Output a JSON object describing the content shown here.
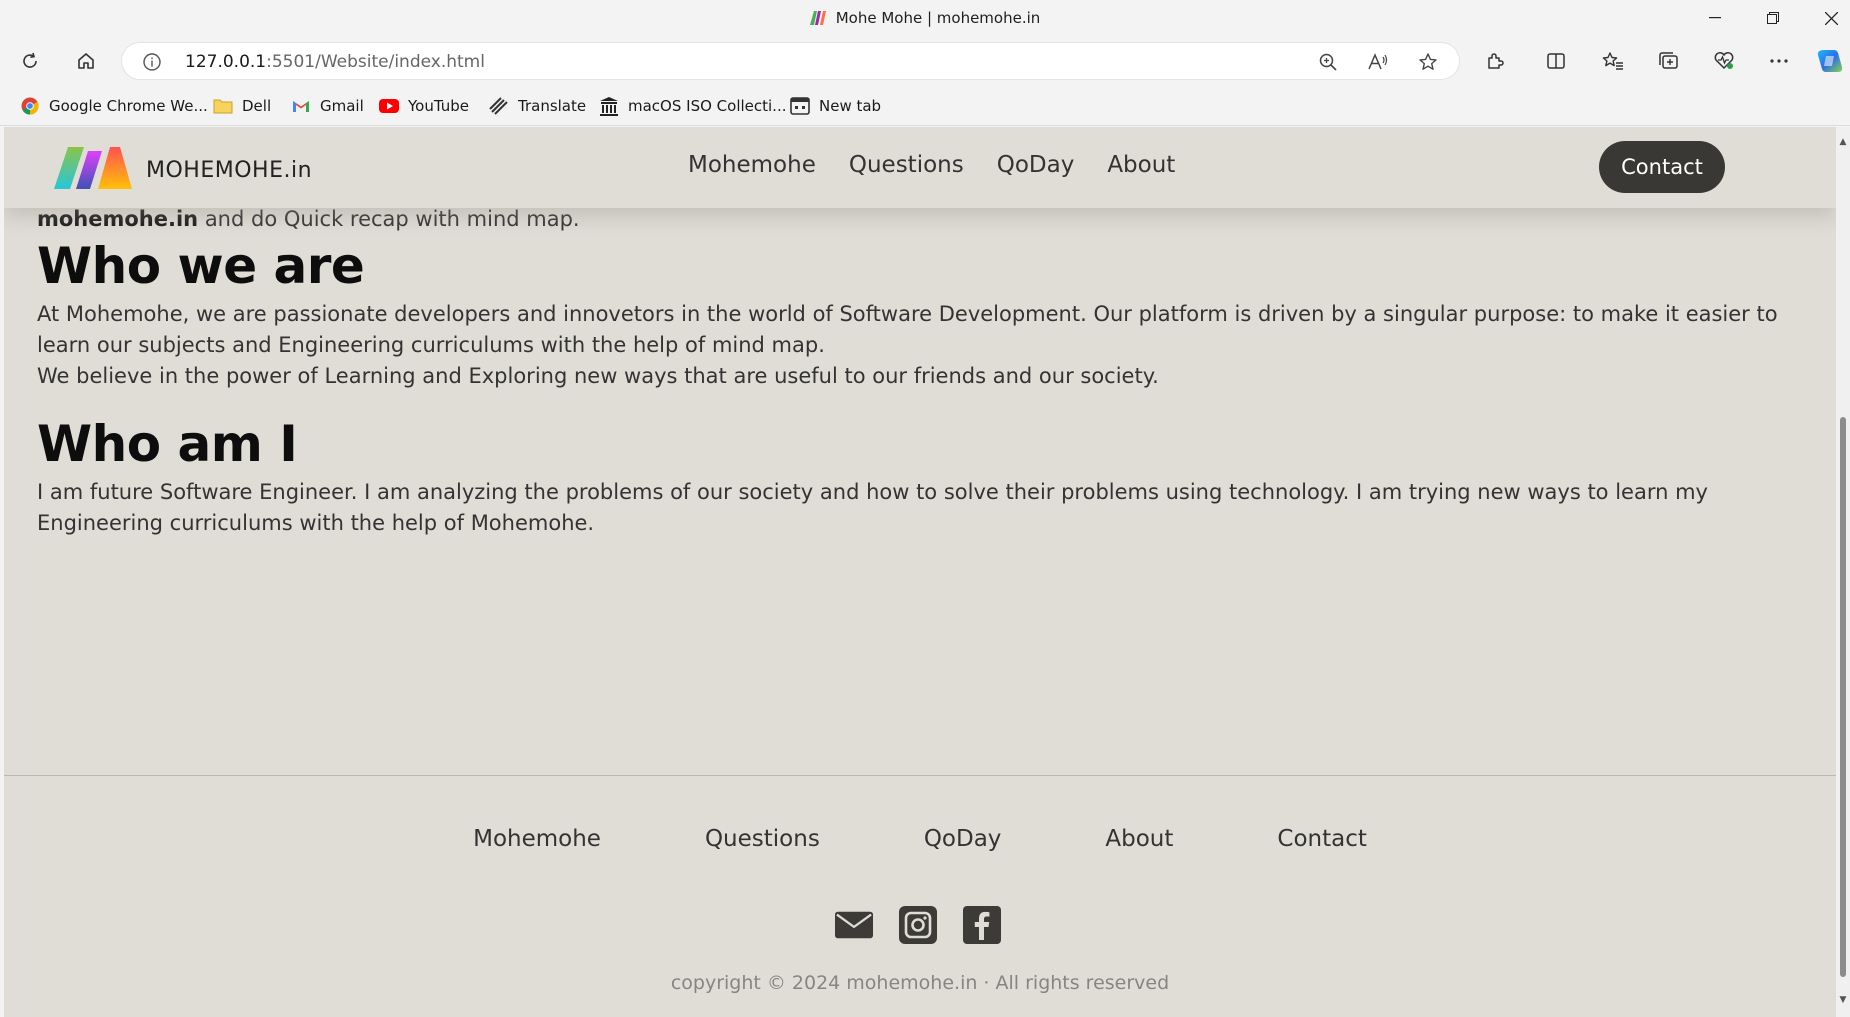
{
  "window": {
    "title": "Mohe Mohe | mohemohe.in"
  },
  "address_bar": {
    "url_host": "127.0.0.1",
    "url_rest": ":5501/Website/index.html"
  },
  "bookmarks": [
    {
      "label": "Google Chrome We...",
      "icon": "chrome-icon"
    },
    {
      "label": "Dell",
      "icon": "folder-icon"
    },
    {
      "label": "Gmail",
      "icon": "gmail-icon"
    },
    {
      "label": "YouTube",
      "icon": "youtube-icon"
    },
    {
      "label": "Translate",
      "icon": "translate-icon"
    },
    {
      "label": "macOS ISO Collecti...",
      "icon": "archive-icon"
    },
    {
      "label": "New tab",
      "icon": "newtab-icon"
    }
  ],
  "site": {
    "brand": "MOHEMOHE.in",
    "nav": [
      "Mohemohe",
      "Questions",
      "QoDay",
      "About"
    ],
    "contact_label": "Contact"
  },
  "content": {
    "intro_bold": "mohemohe.in",
    "intro_rest": " and do Quick recap with mind map.",
    "who_we_are_heading": "Who we are",
    "who_we_are_p1": "At Mohemohe, we are passionate developers and innovetors in the world of Software Development. Our platform is driven by a singular purpose: to make it easier to learn our subjects and Engineering curriculums with the help of mind map.",
    "who_we_are_p2": "We believe in the power of Learning and Exploring new ways that are useful to our friends and our society.",
    "who_am_i_heading": "Who am I",
    "who_am_i_p1": "I am future Software Engineer. I am analyzing the problems of our society and how to solve their problems using technology. I am trying new ways to learn my Engineering curriculums with the help of Mohemohe."
  },
  "footer": {
    "nav": [
      "Mohemohe",
      "Questions",
      "QoDay",
      "About",
      "Contact"
    ],
    "socials": [
      "mail-icon",
      "instagram-icon",
      "facebook-icon"
    ],
    "copyright": "copyright © 2024 mohemohe.in · All rights reserved"
  },
  "colors": {
    "page_bg": "#e0ddd7",
    "contact_bg": "#3a3835",
    "text": "#333333"
  }
}
